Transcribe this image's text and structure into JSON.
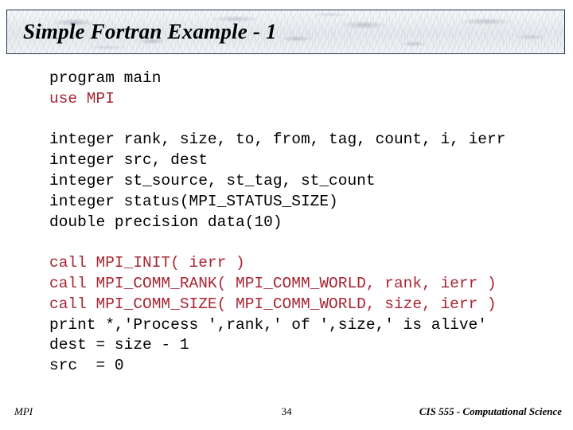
{
  "slide": {
    "title": "Simple Fortran Example - 1",
    "title_border_color": "#243050",
    "background_color": "#ffffff"
  },
  "code": {
    "keyword_color": "#A72532",
    "text_color": "#000000",
    "lines": [
      {
        "text": "program main",
        "color": "black"
      },
      {
        "text": "use MPI",
        "color": "red"
      },
      {
        "text": "",
        "color": "black"
      },
      {
        "text": "integer rank, size, to, from, tag, count, i, ierr",
        "color": "black"
      },
      {
        "text": "integer src, dest",
        "color": "black"
      },
      {
        "text": "integer st_source, st_tag, st_count",
        "color": "black"
      },
      {
        "text": "integer status(MPI_STATUS_SIZE)",
        "color": "black"
      },
      {
        "text": "double precision data(10)",
        "color": "black"
      },
      {
        "text": "",
        "color": "black"
      },
      {
        "text": "call MPI_INIT( ierr )",
        "color": "red"
      },
      {
        "text": "call MPI_COMM_RANK( MPI_COMM_WORLD, rank, ierr )",
        "color": "red"
      },
      {
        "text": "call MPI_COMM_SIZE( MPI_COMM_WORLD, size, ierr )",
        "color": "red"
      },
      {
        "text": "print *,'Process ',rank,' of ',size,' is alive'",
        "color": "black"
      },
      {
        "text": "dest = size - 1",
        "color": "black"
      },
      {
        "text": "src  = 0",
        "color": "black"
      }
    ]
  },
  "footer": {
    "left": "MPI",
    "page_number": "34",
    "right": "CIS 555 - Computational Science"
  }
}
